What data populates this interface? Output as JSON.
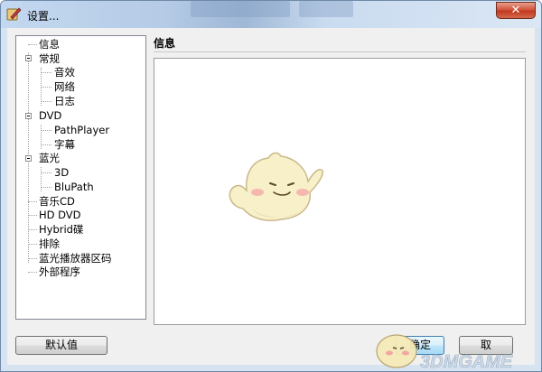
{
  "window": {
    "title": "设置...",
    "close_label": "✕"
  },
  "tree": {
    "items": [
      {
        "label": "信息"
      },
      {
        "label": "常规",
        "expanded": true
      },
      {
        "label": "音效"
      },
      {
        "label": "网络"
      },
      {
        "label": "日志"
      },
      {
        "label": "DVD",
        "expanded": true
      },
      {
        "label": "PathPlayer"
      },
      {
        "label": "字幕"
      },
      {
        "label": "蓝光",
        "expanded": true
      },
      {
        "label": "3D"
      },
      {
        "label": "BluPath"
      },
      {
        "label": "音乐CD"
      },
      {
        "label": "HD DVD"
      },
      {
        "label": "Hybrid碟"
      },
      {
        "label": "排除"
      },
      {
        "label": "蓝光播放器区码"
      },
      {
        "label": "外部程序"
      }
    ]
  },
  "panel": {
    "title": "信息"
  },
  "buttons": {
    "default_label": "默认值",
    "ok_label": "确定",
    "cancel_label": "取"
  },
  "watermark": {
    "text": "3DMGAME"
  },
  "colors": {
    "titlebar": "#b9cee8",
    "close": "#c9462b",
    "ok_border": "#3c7fb1",
    "watermark": "#d9e4ef"
  }
}
